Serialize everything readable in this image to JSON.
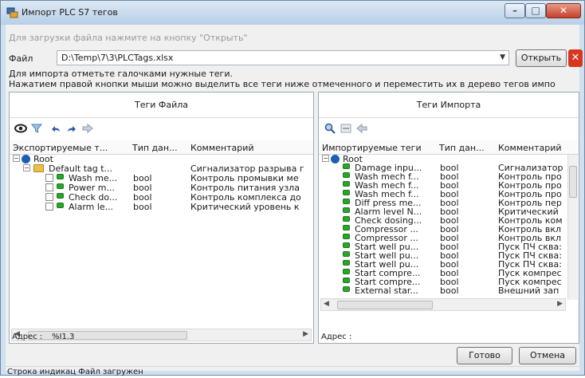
{
  "window": {
    "title": "Импорт PLC S7 тегов"
  },
  "top": {
    "hint": "Для загрузки файла нажмите на кнопку \"Открыть\"",
    "file_label": "Файл",
    "file_value": "D:\\Temp\\7\\3\\PLCTags.xlsx",
    "open_label": "Открыть",
    "instr1": "Для импорта отметьте галочками нужные теги.",
    "instr2": "Нажатием правой кнопки мыши можно выделить все теги ниже отмеченного и переместить их в дерево тегов импо"
  },
  "left": {
    "title": "Теги Файла",
    "columns": [
      "Экспортируемые т...",
      "Тип дан...",
      "Комментарий"
    ],
    "root": "Root",
    "group": "Default tag t...",
    "group_comment": "Сигнализатор разрыва г",
    "rows": [
      {
        "name": "Wash me...",
        "type": "bool",
        "comment": "Контроль промывки ме"
      },
      {
        "name": "Power m...",
        "type": "bool",
        "comment": "Контроль питания узла"
      },
      {
        "name": "Check do...",
        "type": "bool",
        "comment": "Контроль комплекса до"
      },
      {
        "name": "Alarm le...",
        "type": "bool",
        "comment": "Критический уровень к"
      }
    ],
    "address_label": "Адрес :",
    "address_value": "%I1.3"
  },
  "right": {
    "title": "Теги Импорта",
    "columns": [
      "Импортируемые теги",
      "Тип дан...",
      "Комментарий"
    ],
    "root": "Root",
    "rows": [
      {
        "name": "Damage inpu...",
        "type": "bool",
        "comment": "Сигнализатор"
      },
      {
        "name": "Wash mech f...",
        "type": "bool",
        "comment": "Контроль про"
      },
      {
        "name": "Wash mech f...",
        "type": "bool",
        "comment": "Контроль про"
      },
      {
        "name": "Wash mech f...",
        "type": "bool",
        "comment": "Контроль про"
      },
      {
        "name": "Diff press me...",
        "type": "bool",
        "comment": "Контроль пер"
      },
      {
        "name": "Alarm level N...",
        "type": "bool",
        "comment": "Критический"
      },
      {
        "name": "Check dosing...",
        "type": "bool",
        "comment": "Контроль ком"
      },
      {
        "name": "Compressor ...",
        "type": "bool",
        "comment": "Контроль вкл"
      },
      {
        "name": "Compressor ...",
        "type": "bool",
        "comment": "Контроль вкл"
      },
      {
        "name": "Start well pu...",
        "type": "bool",
        "comment": "Пуск ПЧ сква:"
      },
      {
        "name": "Start well pu...",
        "type": "bool",
        "comment": "Пуск ПЧ сква:"
      },
      {
        "name": "Start well pu...",
        "type": "bool",
        "comment": "Пуск ПЧ сква:"
      },
      {
        "name": "Start compre...",
        "type": "bool",
        "comment": "Пуск компрес"
      },
      {
        "name": "Start compre...",
        "type": "bool",
        "comment": "Пуск компрес"
      },
      {
        "name": "External star...",
        "type": "bool",
        "comment": "Внешний зап"
      }
    ],
    "address_label": "Адрес :"
  },
  "buttons": {
    "ok": "Готово",
    "cancel": "Отмена"
  },
  "status": "Строка индикац Файл загружен"
}
